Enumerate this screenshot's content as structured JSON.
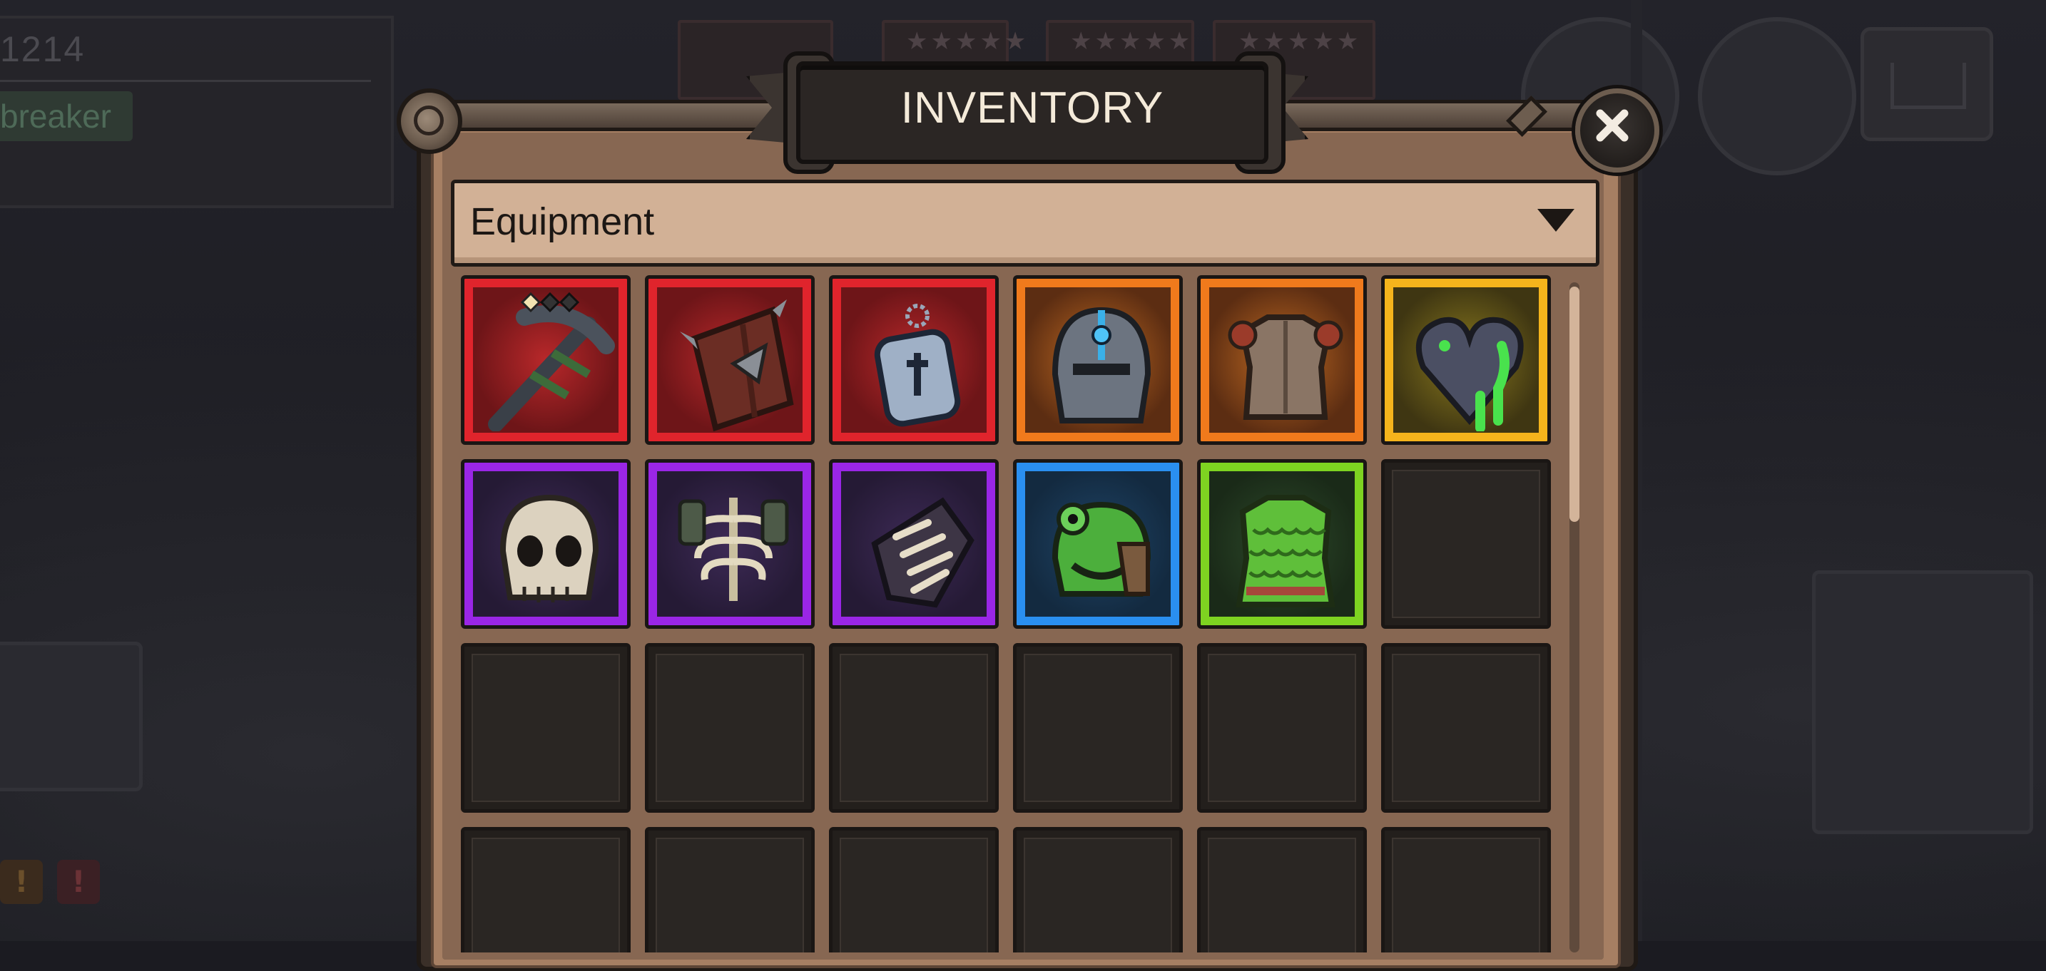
{
  "background": {
    "stat_value": "1214",
    "player_name": "breaker",
    "alert_symbols": [
      "!",
      "!"
    ]
  },
  "window": {
    "title": "INVENTORY"
  },
  "filter": {
    "selected": "Equipment"
  },
  "inventory": {
    "rarity_colors": {
      "red": "#e0242c",
      "orange": "#f07a1c",
      "yellow": "#f5b41c",
      "purple": "#9a26e6",
      "blue": "#2a8ff0",
      "green": "#7ed321"
    },
    "rows": [
      [
        {
          "item": "thorned-pickaxe-icon",
          "rarity": "red"
        },
        {
          "item": "spiked-wooden-shield-icon",
          "rarity": "red"
        },
        {
          "item": "dog-tag-amulet-icon",
          "rarity": "red"
        },
        {
          "item": "great-helm-icon",
          "rarity": "orange"
        },
        {
          "item": "steel-chestplate-icon",
          "rarity": "orange"
        },
        {
          "item": "slimy-heart-icon",
          "rarity": "yellow"
        }
      ],
      [
        {
          "item": "skull-helm-icon",
          "rarity": "purple"
        },
        {
          "item": "ribcage-armor-icon",
          "rarity": "purple"
        },
        {
          "item": "bone-gauntlet-icon",
          "rarity": "purple"
        },
        {
          "item": "frog-helm-icon",
          "rarity": "blue"
        },
        {
          "item": "scale-mail-icon",
          "rarity": "green"
        },
        null
      ],
      [
        null,
        null,
        null,
        null,
        null,
        null
      ],
      [
        null,
        null,
        null,
        null,
        null,
        null
      ]
    ]
  }
}
